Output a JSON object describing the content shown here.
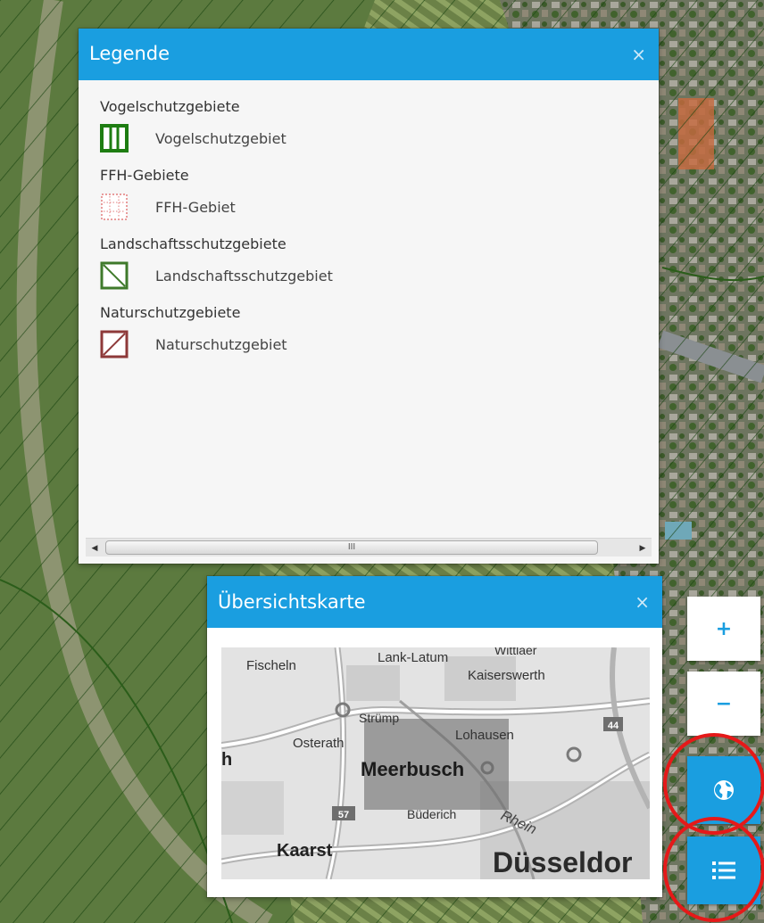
{
  "legend_panel": {
    "title": "Legende",
    "close_label": "×",
    "groups": [
      {
        "title": "Vogelschutzgebiete",
        "item_label": "Vogelschutzgebiet",
        "icon": "bird-protection-swatch",
        "color": "#1e7d12"
      },
      {
        "title": "FFH-Gebiete",
        "item_label": "FFH-Gebiet",
        "icon": "ffh-swatch",
        "color": "#e37d7d"
      },
      {
        "title": "Landschaftsschutzgebiete",
        "item_label": "Landschaftsschutzgebiet",
        "icon": "landscape-protection-swatch",
        "color": "#3f7a2b"
      },
      {
        "title": "Naturschutzgebiete",
        "item_label": "Naturschutzgebiet",
        "icon": "nature-reserve-swatch",
        "color": "#8e3a3a"
      }
    ],
    "scrollbar": {
      "left_arrow": "◀",
      "right_arrow": "▶",
      "thumb_grip": "III"
    }
  },
  "overview_panel": {
    "title": "Übersichtskarte",
    "close_label": "×",
    "map_labels": {
      "fischeln": "Fischeln",
      "lank_latum": "Lank-Latum",
      "wittlaer": "Wittlaer",
      "kaiserswerth": "Kaiserswerth",
      "struemp": "Strümp",
      "osterath": "Osterath",
      "lohausen": "Lohausen",
      "h": "h",
      "meerbusch": "Meerbusch",
      "buederich": "Büderich",
      "rhein": "Rhein",
      "kaarst": "Kaarst",
      "duesseldorf": "Düsseldor",
      "road_57": "57",
      "road_44": "44"
    }
  },
  "map_controls": {
    "zoom_in": "+",
    "zoom_out": "−",
    "globe_icon": "globe-icon",
    "layers_icon": "list-icon"
  },
  "colors": {
    "accent": "#1a9ee0",
    "annotation_ring": "#e51919"
  }
}
